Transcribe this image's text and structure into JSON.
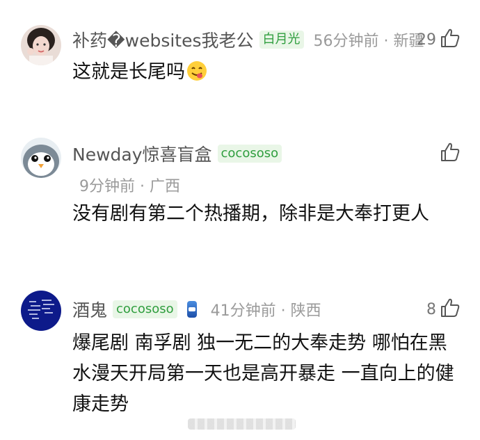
{
  "comments": [
    {
      "username": "补药�websites我老公",
      "badge": "白月光",
      "meta": "56分钟前 · 新疆",
      "likes": "29",
      "text": "这就是长尾吗",
      "emoji": "yum-face-emoji",
      "avatar": "girl-photo-avatar"
    },
    {
      "username": "Newday惊喜盲盒",
      "badge": "cocososo",
      "meta": "9分钟前 · 广西",
      "likes": "",
      "text": "没有剧有第二个热播期，除非是大奉打更人",
      "avatar": "penguin-avatar"
    },
    {
      "username": "酒鬼",
      "badge": "cocososo",
      "meta": "41分钟前 · 陕西",
      "likes": "8",
      "text": "爆尾剧 南孚剧 独一无二的大奉走势 哪怕在黑水漫天开局第一天也是高开暴走 一直向上的健康走势",
      "avatar": "handwritten-blue-avatar"
    }
  ],
  "colors": {
    "badge_text": "#2f9e3e",
    "badge_bg": "#e9f6e7",
    "meta": "#9a9a9a"
  }
}
